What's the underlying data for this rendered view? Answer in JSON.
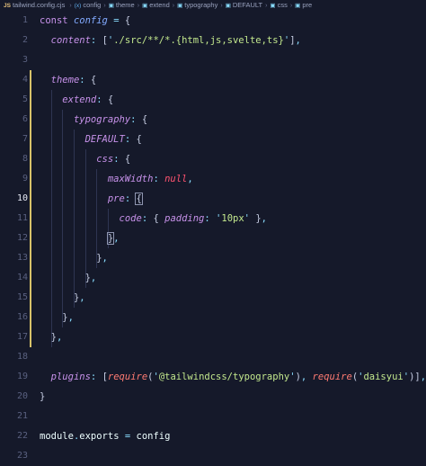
{
  "breadcrumb": {
    "file": "tailwind.config.cjs",
    "items": [
      {
        "label": "config",
        "icon": "variable-icon"
      },
      {
        "label": "theme",
        "icon": "property-icon"
      },
      {
        "label": "extend",
        "icon": "property-icon"
      },
      {
        "label": "typography",
        "icon": "property-icon"
      },
      {
        "label": "DEFAULT",
        "icon": "property-icon"
      },
      {
        "label": "css",
        "icon": "property-icon"
      },
      {
        "label": "pre",
        "icon": "property-icon"
      }
    ]
  },
  "editor": {
    "active_line": 10,
    "modified_lines": [
      4,
      17
    ],
    "colors": {
      "background": "#15192a",
      "modified_bar": "#d8c36a"
    },
    "lines": [
      {
        "n": "1",
        "tokens": [
          [
            "kw",
            "const "
          ],
          [
            "var",
            "config"
          ],
          [
            "plain",
            " "
          ],
          [
            "punc",
            "="
          ],
          [
            "plain",
            " "
          ],
          [
            "brace",
            "{"
          ]
        ]
      },
      {
        "n": "2",
        "tokens": [
          [
            "plain",
            "  "
          ],
          [
            "key",
            "content"
          ],
          [
            "punc",
            ":"
          ],
          [
            "plain",
            " "
          ],
          [
            "brace",
            "["
          ],
          [
            "punc",
            "'"
          ],
          [
            "str",
            "./src/**/*.{html,js,svelte,ts}"
          ],
          [
            "punc",
            "'"
          ],
          [
            "brace",
            "]"
          ],
          [
            "punc",
            ","
          ]
        ]
      },
      {
        "n": "3",
        "tokens": []
      },
      {
        "n": "4",
        "tokens": [
          [
            "plain",
            "  "
          ],
          [
            "key",
            "theme"
          ],
          [
            "punc",
            ":"
          ],
          [
            "plain",
            " "
          ],
          [
            "brace",
            "{"
          ]
        ]
      },
      {
        "n": "5",
        "tokens": [
          [
            "plain",
            "    "
          ],
          [
            "key",
            "extend"
          ],
          [
            "punc",
            ":"
          ],
          [
            "plain",
            " "
          ],
          [
            "brace",
            "{"
          ]
        ]
      },
      {
        "n": "6",
        "tokens": [
          [
            "plain",
            "      "
          ],
          [
            "key",
            "typography"
          ],
          [
            "punc",
            ":"
          ],
          [
            "plain",
            " "
          ],
          [
            "brace",
            "{"
          ]
        ]
      },
      {
        "n": "7",
        "tokens": [
          [
            "plain",
            "        "
          ],
          [
            "key",
            "DEFAULT"
          ],
          [
            "punc",
            ":"
          ],
          [
            "plain",
            " "
          ],
          [
            "brace",
            "{"
          ]
        ]
      },
      {
        "n": "8",
        "tokens": [
          [
            "plain",
            "          "
          ],
          [
            "key",
            "css"
          ],
          [
            "punc",
            ":"
          ],
          [
            "plain",
            " "
          ],
          [
            "brace",
            "{"
          ]
        ]
      },
      {
        "n": "9",
        "tokens": [
          [
            "plain",
            "            "
          ],
          [
            "key",
            "maxWidth"
          ],
          [
            "punc",
            ":"
          ],
          [
            "plain",
            " "
          ],
          [
            "null",
            "null"
          ],
          [
            "punc",
            ","
          ]
        ]
      },
      {
        "n": "10",
        "tokens": [
          [
            "plain",
            "            "
          ],
          [
            "key",
            "pre"
          ],
          [
            "punc",
            ":"
          ],
          [
            "plain",
            " "
          ],
          [
            "match",
            "{"
          ]
        ]
      },
      {
        "n": "11",
        "tokens": [
          [
            "plain",
            "              "
          ],
          [
            "key",
            "code"
          ],
          [
            "punc",
            ":"
          ],
          [
            "plain",
            " "
          ],
          [
            "brace",
            "{"
          ],
          [
            "plain",
            " "
          ],
          [
            "key",
            "padding"
          ],
          [
            "punc",
            ":"
          ],
          [
            "plain",
            " "
          ],
          [
            "punc",
            "'"
          ],
          [
            "str",
            "10px"
          ],
          [
            "punc",
            "'"
          ],
          [
            "plain",
            " "
          ],
          [
            "brace",
            "}"
          ],
          [
            "punc",
            ","
          ]
        ]
      },
      {
        "n": "12",
        "tokens": [
          [
            "plain",
            "            "
          ],
          [
            "match",
            "}"
          ],
          [
            "punc",
            ","
          ]
        ]
      },
      {
        "n": "13",
        "tokens": [
          [
            "plain",
            "          "
          ],
          [
            "brace",
            "}"
          ],
          [
            "punc",
            ","
          ]
        ]
      },
      {
        "n": "14",
        "tokens": [
          [
            "plain",
            "        "
          ],
          [
            "brace",
            "}"
          ],
          [
            "punc",
            ","
          ]
        ]
      },
      {
        "n": "15",
        "tokens": [
          [
            "plain",
            "      "
          ],
          [
            "brace",
            "}"
          ],
          [
            "punc",
            ","
          ]
        ]
      },
      {
        "n": "16",
        "tokens": [
          [
            "plain",
            "    "
          ],
          [
            "brace",
            "}"
          ],
          [
            "punc",
            ","
          ]
        ]
      },
      {
        "n": "17",
        "tokens": [
          [
            "plain",
            "  "
          ],
          [
            "brace",
            "}"
          ],
          [
            "punc",
            ","
          ]
        ]
      },
      {
        "n": "18",
        "tokens": []
      },
      {
        "n": "19",
        "tokens": [
          [
            "plain",
            "  "
          ],
          [
            "key",
            "plugins"
          ],
          [
            "punc",
            ":"
          ],
          [
            "plain",
            " "
          ],
          [
            "brace",
            "["
          ],
          [
            "fn",
            "require"
          ],
          [
            "brace",
            "("
          ],
          [
            "punc",
            "'"
          ],
          [
            "str",
            "@tailwindcss/typography"
          ],
          [
            "punc",
            "'"
          ],
          [
            "brace",
            ")"
          ],
          [
            "punc",
            ","
          ],
          [
            "plain",
            " "
          ],
          [
            "fn",
            "require"
          ],
          [
            "brace",
            "("
          ],
          [
            "punc",
            "'"
          ],
          [
            "str",
            "daisyui"
          ],
          [
            "punc",
            "'"
          ],
          [
            "brace",
            ")"
          ],
          [
            "brace",
            "]"
          ],
          [
            "punc",
            ","
          ]
        ]
      },
      {
        "n": "20",
        "tokens": [
          [
            "brace",
            "}"
          ]
        ]
      },
      {
        "n": "21",
        "tokens": []
      },
      {
        "n": "22",
        "tokens": [
          [
            "mod",
            "module"
          ],
          [
            "punc",
            "."
          ],
          [
            "mod",
            "exports"
          ],
          [
            "plain",
            " "
          ],
          [
            "punc",
            "="
          ],
          [
            "plain",
            " "
          ],
          [
            "mod",
            "config"
          ]
        ]
      },
      {
        "n": "23",
        "tokens": []
      }
    ]
  }
}
